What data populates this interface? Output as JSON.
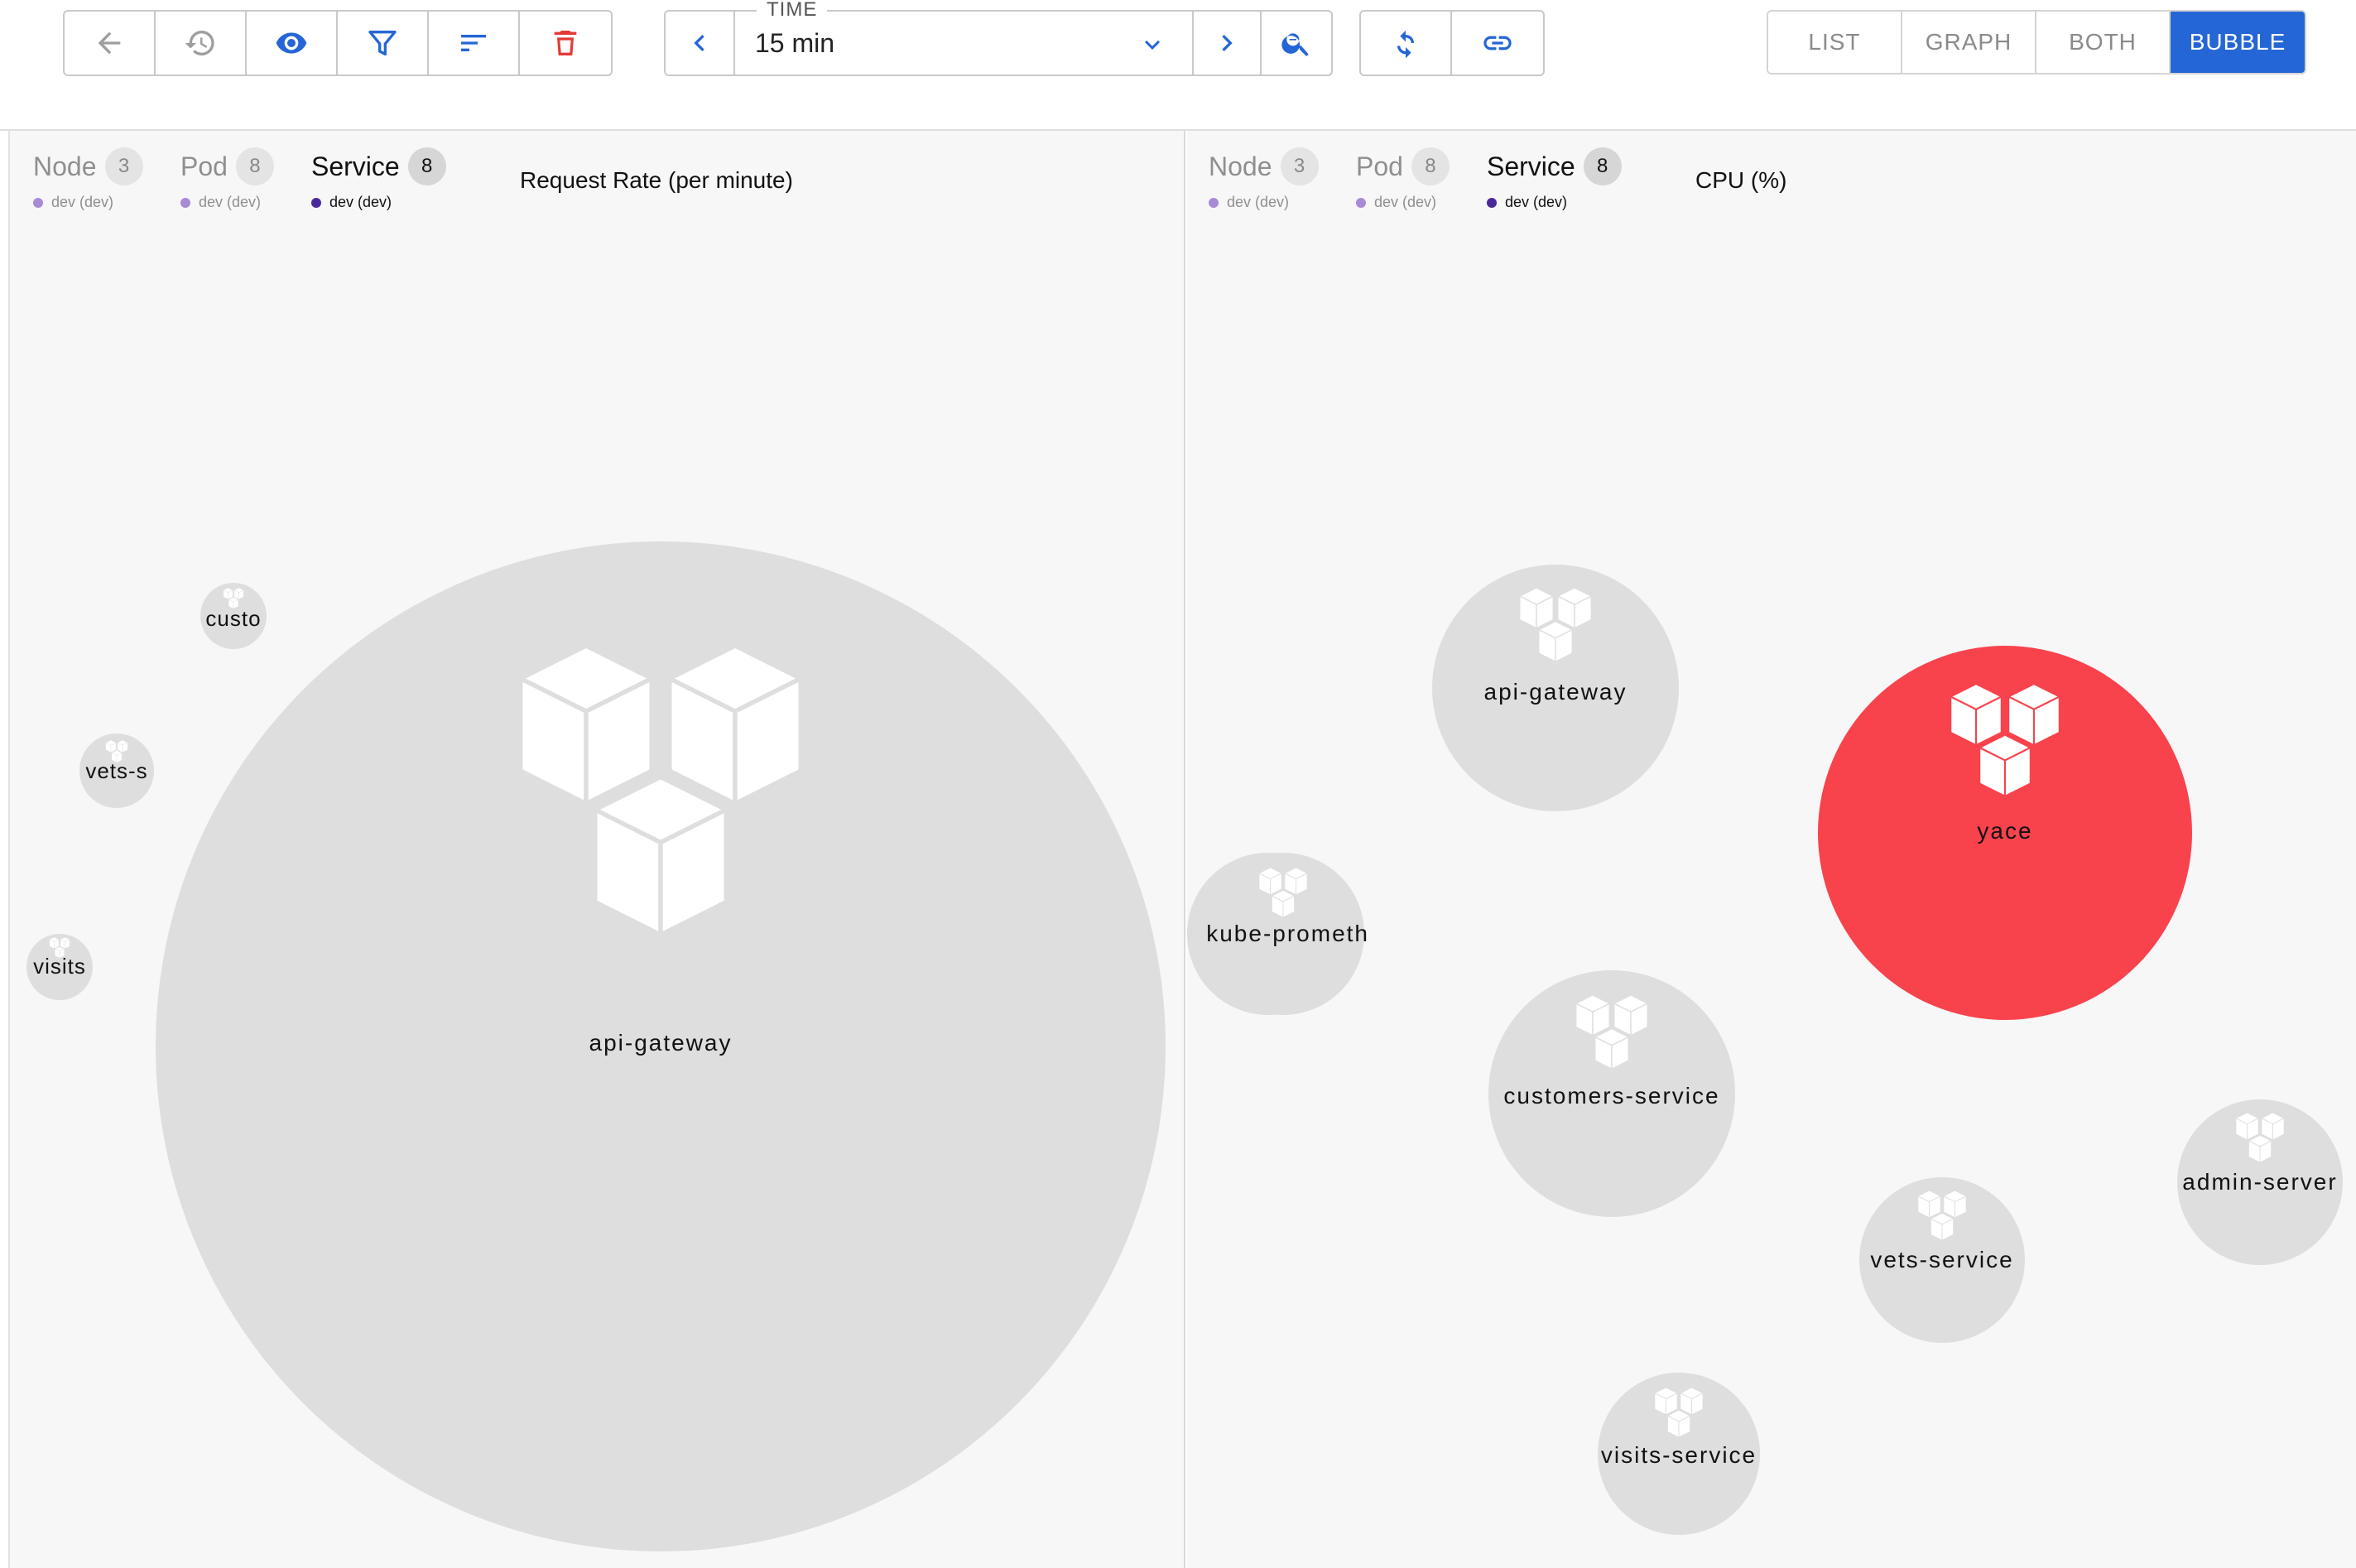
{
  "toolbar": {
    "left_buttons": [
      "back-icon",
      "history-icon",
      "eye-icon",
      "filter-icon",
      "sort-icon",
      "delete-icon"
    ],
    "time": {
      "legend": "TIME",
      "value": "15 min"
    },
    "right_buttons": [
      "refresh-icon",
      "link-icon"
    ],
    "views": [
      {
        "label": "LIST",
        "active": false
      },
      {
        "label": "GRAPH",
        "active": false
      },
      {
        "label": "BOTH",
        "active": false
      },
      {
        "label": "BUBBLE",
        "active": true
      }
    ]
  },
  "legend": {
    "node": {
      "label": "Node",
      "count": "3",
      "sub": "dev (dev)"
    },
    "pod": {
      "label": "Pod",
      "count": "8",
      "sub": "dev (dev)"
    },
    "service": {
      "label": "Service",
      "count": "8",
      "sub": "dev (dev)"
    }
  },
  "left_panel": {
    "metric": "Request Rate (per minute)",
    "bubbles": {
      "custo": "custo",
      "vets_s": "vets-s",
      "visits": "visits",
      "api_gateway": "api-gateway"
    }
  },
  "right_panel": {
    "metric": "CPU (%)",
    "bubbles": {
      "api_gateway": "api-gateway",
      "yace": "yace",
      "kube_prometh": "kube-prometh",
      "customers_service": "customers-service",
      "admin_server": "admin-server",
      "vets_service": "vets-service",
      "visits_service": "visits-service"
    }
  },
  "colors": {
    "accent": "#2566d6",
    "danger": "#e53935",
    "hot_bubble": "#f8434d",
    "bubble": "#dedede"
  }
}
